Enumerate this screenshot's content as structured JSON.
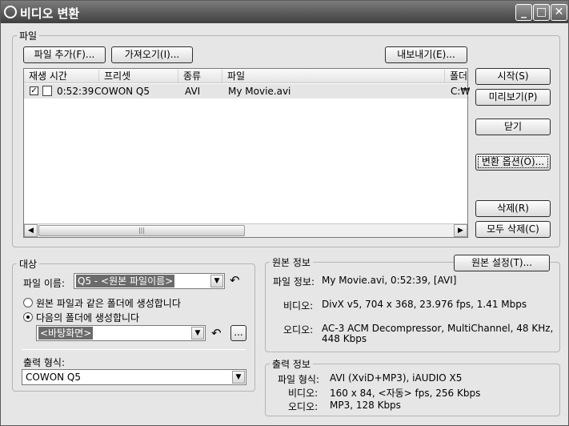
{
  "window": {
    "title": "비디오 변환",
    "min": "_",
    "max": "□",
    "close": "✕"
  },
  "file_group": {
    "legend": "파일",
    "add_file": "파일 추가(F)...",
    "import": "가져오기(I)...",
    "export": "내보내기(E)...",
    "columns": [
      "재생 시간",
      "프리셋",
      "종류",
      "파일",
      "폴더"
    ],
    "rows": [
      {
        "checked": "✓",
        "duration": "0:52:39",
        "preset": "COWON Q5",
        "type": "AVI",
        "file": "My Movie.avi",
        "folder": "C:₩"
      }
    ],
    "scroll": {
      "left": "◀",
      "right": "▶",
      "grip": "|||"
    }
  },
  "side_buttons": {
    "start": "시작(S)",
    "preview": "미리보기(P)",
    "close": "닫기",
    "options": "변환 옵션(O)...",
    "delete": "삭제(R)",
    "delete_all": "모두 삭제(C)"
  },
  "target": {
    "legend": "대상",
    "filename_label": "파일 이름:",
    "filename_value": "Q5 - <원본 파일이름>",
    "radio_same": "원본 파일과 같은 폴더에 생성합니다",
    "radio_folder": "다음의 폴더에 생성합니다",
    "folder_value": "<바탕화면>",
    "browse": "...",
    "output_label": "출력 형식:",
    "output_value": "COWON Q5",
    "arrow": "▼",
    "undo": "↶"
  },
  "source_info": {
    "legend": "원본 정보",
    "settings_button": "원본 설정(T)...",
    "file_label": "파일 정보:",
    "file_value": "My Movie.avi, 0:52:39,  [AVI]",
    "video_label": "비디오:",
    "video_value": "DivX v5, 704 x 368, 23.976 fps, 1.41 Mbps",
    "audio_label": "오디오:",
    "audio_value_1": "AC-3 ACM Decompressor, MultiChannel, 48 KHz,",
    "audio_value_2": "448 Kbps"
  },
  "output_info": {
    "legend": "출력 정보",
    "format_label": "파일 형식:",
    "format_value": "AVI (XviD+MP3), iAUDIO X5",
    "video_label": "비디오:",
    "video_value": "160 x 84, <자동> fps, 256 Kbps",
    "audio_label": "오디오:",
    "audio_value": "MP3, 128 Kbps"
  }
}
